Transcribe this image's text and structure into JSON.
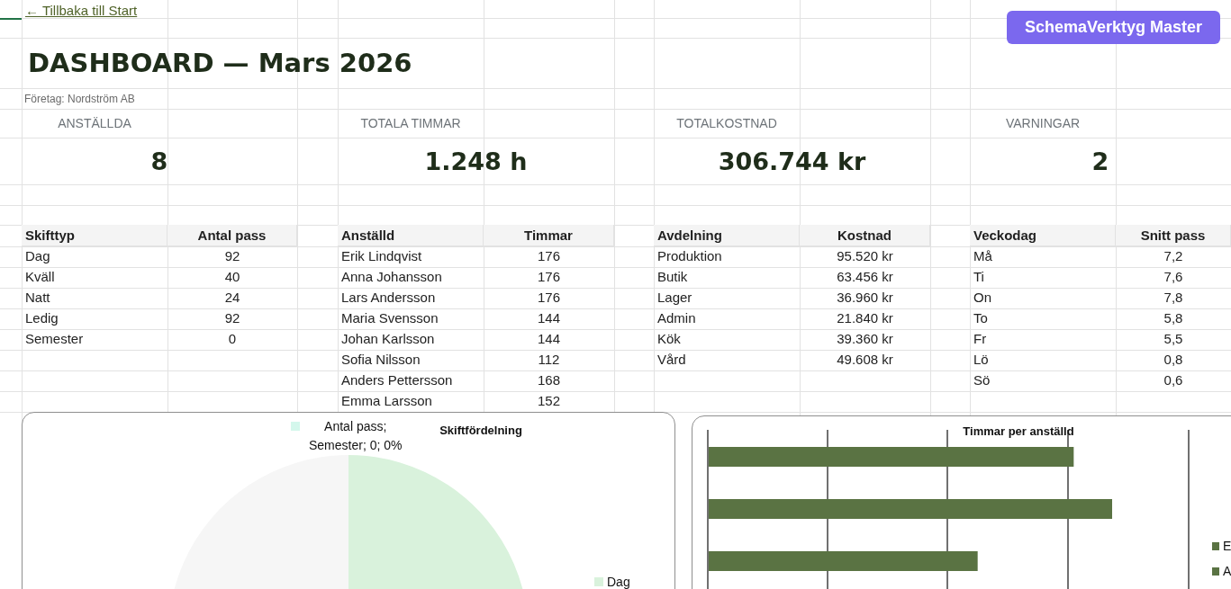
{
  "back_link": "← Tillbaka till Start",
  "badge": "SchemaVerktyg Master",
  "title": "DASHBOARD — Mars 2026",
  "company": "Företag: Nordström AB",
  "kpis": [
    {
      "label": "ANSTÄLLDA",
      "value": "8"
    },
    {
      "label": "TOTALA TIMMAR",
      "value": "1.248 h"
    },
    {
      "label": "TOTALKOSTNAD",
      "value": "306.744 kr"
    },
    {
      "label": "VARNINGAR",
      "value": "2"
    }
  ],
  "tables": [
    {
      "columns": [
        "Skifttyp",
        "Antal pass"
      ],
      "rows": [
        [
          "Dag",
          "92"
        ],
        [
          "Kväll",
          "40"
        ],
        [
          "Natt",
          "24"
        ],
        [
          "Ledig",
          "92"
        ],
        [
          "Semester",
          "0"
        ]
      ]
    },
    {
      "columns": [
        "Anställd",
        "Timmar"
      ],
      "rows": [
        [
          "Erik Lindqvist",
          "176"
        ],
        [
          "Anna Johansson",
          "176"
        ],
        [
          "Lars Andersson",
          "176"
        ],
        [
          "Maria Svensson",
          "144"
        ],
        [
          "Johan Karlsson",
          "144"
        ],
        [
          "Sofia Nilsson",
          "112"
        ],
        [
          "Anders Pettersson",
          "168"
        ],
        [
          "Emma Larsson",
          "152"
        ]
      ]
    },
    {
      "columns": [
        "Avdelning",
        "Kostnad"
      ],
      "rows": [
        [
          "Produktion",
          "95.520 kr"
        ],
        [
          "Butik",
          "63.456 kr"
        ],
        [
          "Lager",
          "36.960 kr"
        ],
        [
          "Admin",
          "21.840 kr"
        ],
        [
          "Kök",
          "39.360 kr"
        ],
        [
          "Vård",
          "49.608 kr"
        ]
      ]
    },
    {
      "columns": [
        "Veckodag",
        "Snitt pass"
      ],
      "rows": [
        [
          "Må",
          "7,2"
        ],
        [
          "Ti",
          "7,6"
        ],
        [
          "On",
          "7,8"
        ],
        [
          "To",
          "5,8"
        ],
        [
          "Fr",
          "5,5"
        ],
        [
          "Lö",
          "0,8"
        ],
        [
          "Sö",
          "0,6"
        ]
      ]
    }
  ],
  "pie_chart": {
    "title": "Skiftfördelning",
    "data_label": {
      "lines": [
        "Antal pass;",
        "Semester; 0; 0%"
      ],
      "color": "#d4f7ec"
    },
    "legend": [
      {
        "label": "Dag",
        "color": "#d9f2dc"
      }
    ]
  },
  "bar_chart": {
    "title": "Timmar per anställd",
    "legend": [
      {
        "label": "E"
      },
      {
        "label": "A"
      }
    ]
  }
}
